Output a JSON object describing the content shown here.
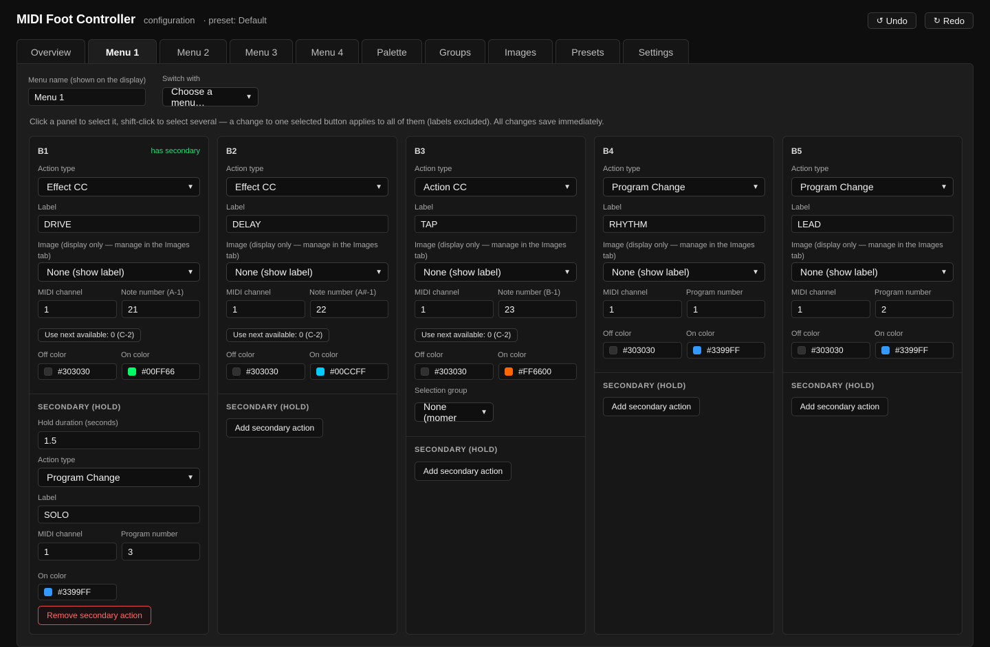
{
  "app": {
    "title": "MIDI Foot Controller",
    "subtitle": "configuration",
    "preset": "· preset: Default"
  },
  "header": {
    "undo": "Undo",
    "redo": "Redo"
  },
  "tabs": [
    "Overview",
    "Menu 1",
    "Menu 2",
    "Menu 3",
    "Menu 4",
    "Palette",
    "Groups",
    "Images",
    "Presets",
    "Settings"
  ],
  "active_tab": "Menu 1",
  "menu": {
    "name_label": "Menu name (shown on the display)",
    "name_value": "Menu 1",
    "switch_label": "Switch with",
    "switch_value": "Choose a menu…",
    "hint": "Click a panel to select it, shift-click to select several — a change to one selected button applies to all of them (labels excluded). All changes save immediately."
  },
  "common": {
    "action_type": "Action type",
    "label": "Label",
    "image": "Image (display only — manage in the Images tab)",
    "midi_channel": "MIDI channel",
    "off_color": "Off color",
    "on_color": "On color",
    "secondary_title": "SECONDARY (HOLD)",
    "add_secondary": "Add secondary action",
    "hold_duration": "Hold duration (seconds)",
    "program_number": "Program number",
    "remove_secondary": "Remove secondary action",
    "selection_group": "Selection group"
  },
  "buttons": [
    {
      "name": "B1",
      "badge": "has secondary",
      "action": "Effect CC",
      "label": "DRIVE",
      "image": "None (show label)",
      "channel": "1",
      "num_label": "Note number (A-1)",
      "num": "21",
      "next": "Use next available: 0 (C-2)",
      "off_color": "#303030",
      "on_color": "#00FF66",
      "secondary": {
        "hold": "1.5",
        "action": "Program Change",
        "label": "SOLO",
        "channel": "1",
        "program": "3",
        "on_color": "#3399FF"
      }
    },
    {
      "name": "B2",
      "action": "Effect CC",
      "label": "DELAY",
      "image": "None (show label)",
      "channel": "1",
      "num_label": "Note number (A#-1)",
      "num": "22",
      "next": "Use next available: 0 (C-2)",
      "off_color": "#303030",
      "on_color": "#00CCFF"
    },
    {
      "name": "B3",
      "action": "Action CC",
      "label": "TAP",
      "image": "None (show label)",
      "channel": "1",
      "num_label": "Note number (B-1)",
      "num": "23",
      "next": "Use next available: 0 (C-2)",
      "off_color": "#303030",
      "on_color": "#FF6600",
      "group": "None (momer"
    },
    {
      "name": "B4",
      "action": "Program Change",
      "label": "RHYTHM",
      "image": "None (show label)",
      "channel": "1",
      "num_label": "Program number",
      "num": "1",
      "off_color": "#303030",
      "on_color": "#3399FF"
    },
    {
      "name": "B5",
      "action": "Program Change",
      "label": "LEAD",
      "image": "None (show label)",
      "channel": "1",
      "num_label": "Program number",
      "num": "2",
      "off_color": "#303030",
      "on_color": "#3399FF"
    }
  ]
}
